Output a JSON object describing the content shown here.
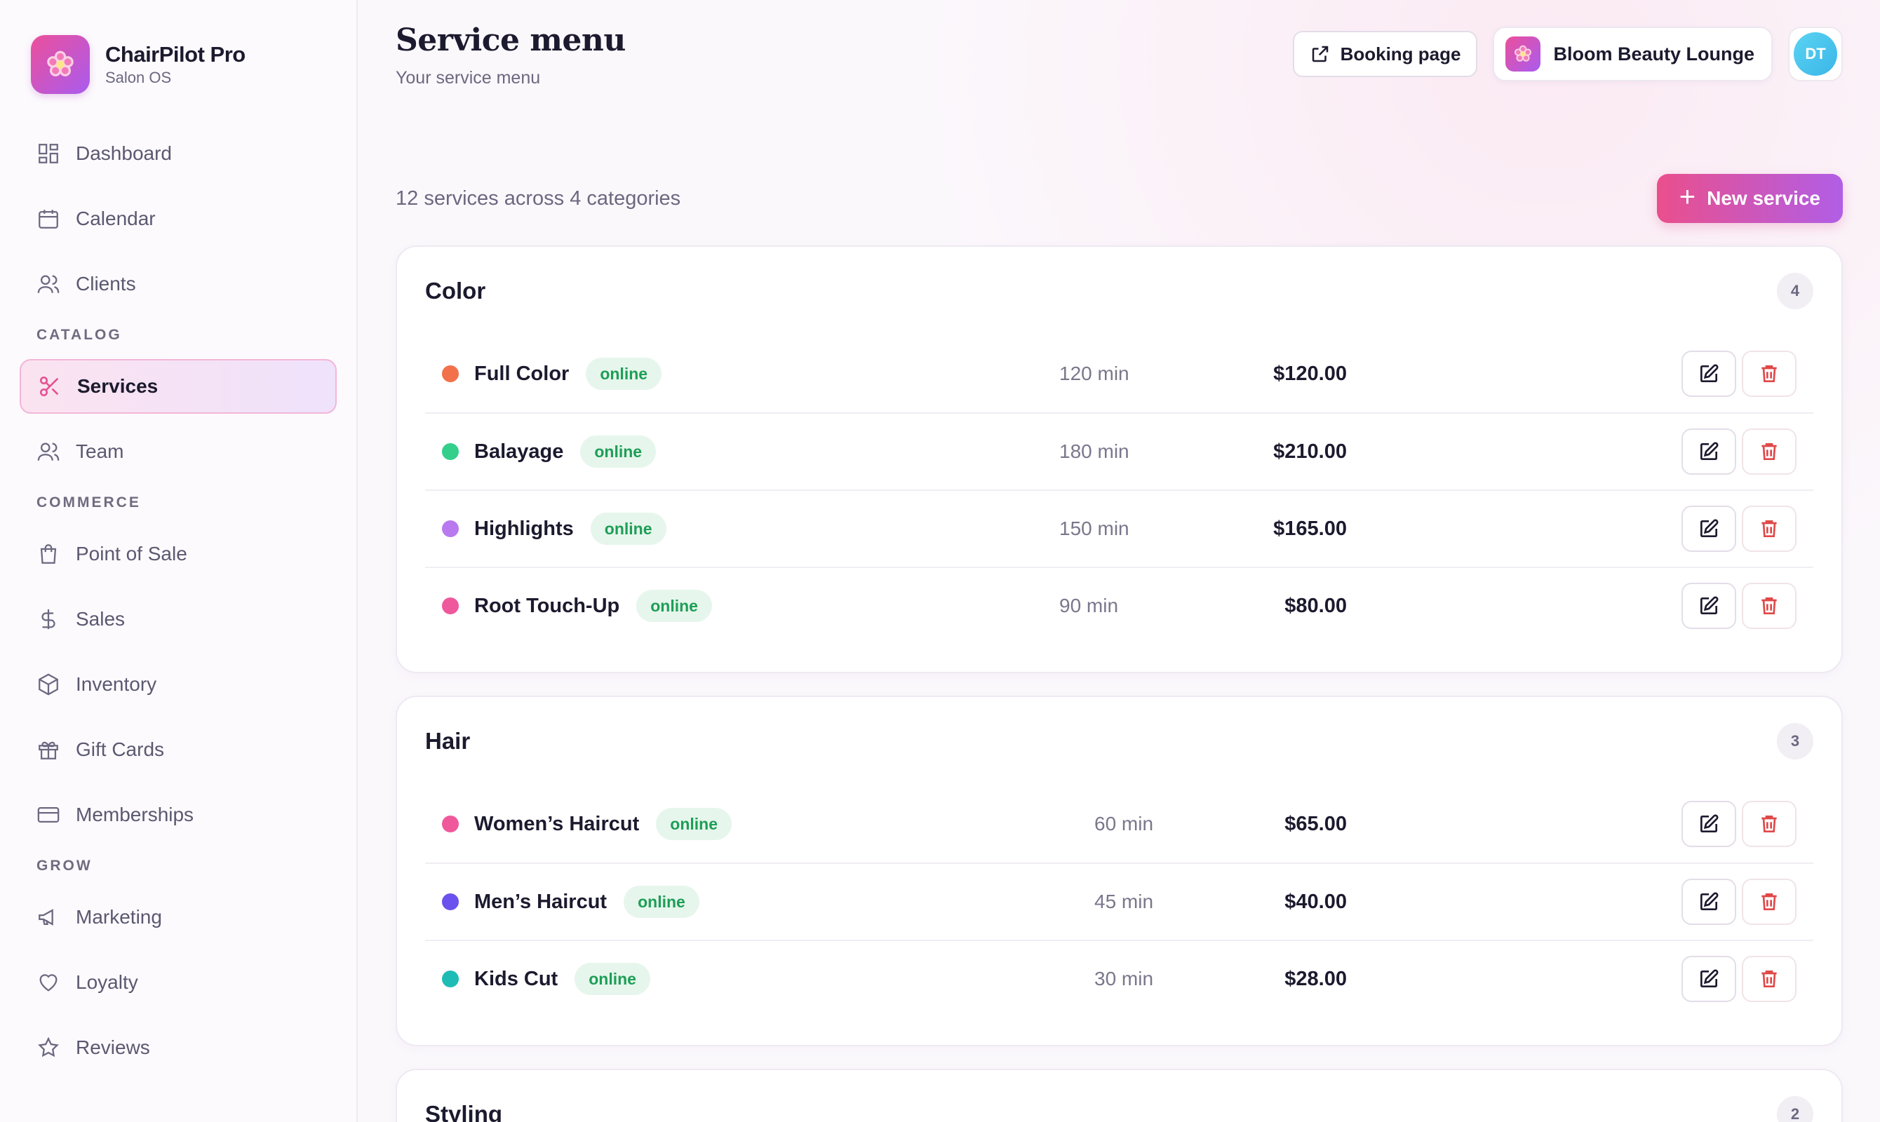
{
  "brand": {
    "name": "ChairPilot Pro",
    "sub": "Salon OS"
  },
  "nav": {
    "main": [
      {
        "label": "Dashboard",
        "icon": "dashboard-icon"
      },
      {
        "label": "Calendar",
        "icon": "calendar-icon"
      },
      {
        "label": "Clients",
        "icon": "users-icon"
      }
    ],
    "catalog_title": "CATALOG",
    "catalog": [
      {
        "label": "Services",
        "icon": "scissors-icon",
        "active": true
      },
      {
        "label": "Team",
        "icon": "team-icon"
      }
    ],
    "commerce_title": "COMMERCE",
    "commerce": [
      {
        "label": "Point of Sale",
        "icon": "shopping-bag-icon"
      },
      {
        "label": "Sales",
        "icon": "dollar-icon"
      },
      {
        "label": "Inventory",
        "icon": "box-icon"
      },
      {
        "label": "Gift Cards",
        "icon": "gift-icon"
      },
      {
        "label": "Memberships",
        "icon": "credit-card-icon"
      }
    ],
    "grow_title": "GROW",
    "grow": [
      {
        "label": "Marketing",
        "icon": "megaphone-icon"
      },
      {
        "label": "Loyalty",
        "icon": "heart-icon"
      },
      {
        "label": "Reviews",
        "icon": "star-icon"
      }
    ]
  },
  "header": {
    "title": "Service menu",
    "subtitle": "Your service menu",
    "booking_label": "Booking page",
    "salon_name": "Bloom Beauty Lounge",
    "avatar_initials": "DT"
  },
  "summary": {
    "text": "12 services across 4 categories",
    "new_service_label": "New service"
  },
  "colors": {
    "accent_start": "#ea4f8c",
    "accent_end": "#b15ee6",
    "online_bg": "#e6f6ec",
    "online_text": "#1e9e57",
    "delete": "#e04848"
  },
  "categories": [
    {
      "name": "Color",
      "count": "4",
      "services": [
        {
          "name": "Full Color",
          "status": "online",
          "duration": "120 min",
          "price": "$120.00",
          "color": "#f2704a"
        },
        {
          "name": "Balayage",
          "status": "online",
          "duration": "180 min",
          "price": "$210.00",
          "color": "#34cf8a"
        },
        {
          "name": "Highlights",
          "status": "online",
          "duration": "150 min",
          "price": "$165.00",
          "color": "#b97af0"
        },
        {
          "name": "Root Touch-Up",
          "status": "online",
          "duration": "90 min",
          "price": "$80.00",
          "color": "#f0589c"
        }
      ]
    },
    {
      "name": "Hair",
      "count": "3",
      "services": [
        {
          "name": "Women’s Haircut",
          "status": "online",
          "duration": "60 min",
          "price": "$65.00",
          "color": "#f0589c"
        },
        {
          "name": "Men’s Haircut",
          "status": "online",
          "duration": "45 min",
          "price": "$40.00",
          "color": "#6b52ee"
        },
        {
          "name": "Kids Cut",
          "status": "online",
          "duration": "30 min",
          "price": "$28.00",
          "color": "#1fbcb6"
        }
      ]
    },
    {
      "name": "Styling",
      "count": "2",
      "services": []
    }
  ]
}
